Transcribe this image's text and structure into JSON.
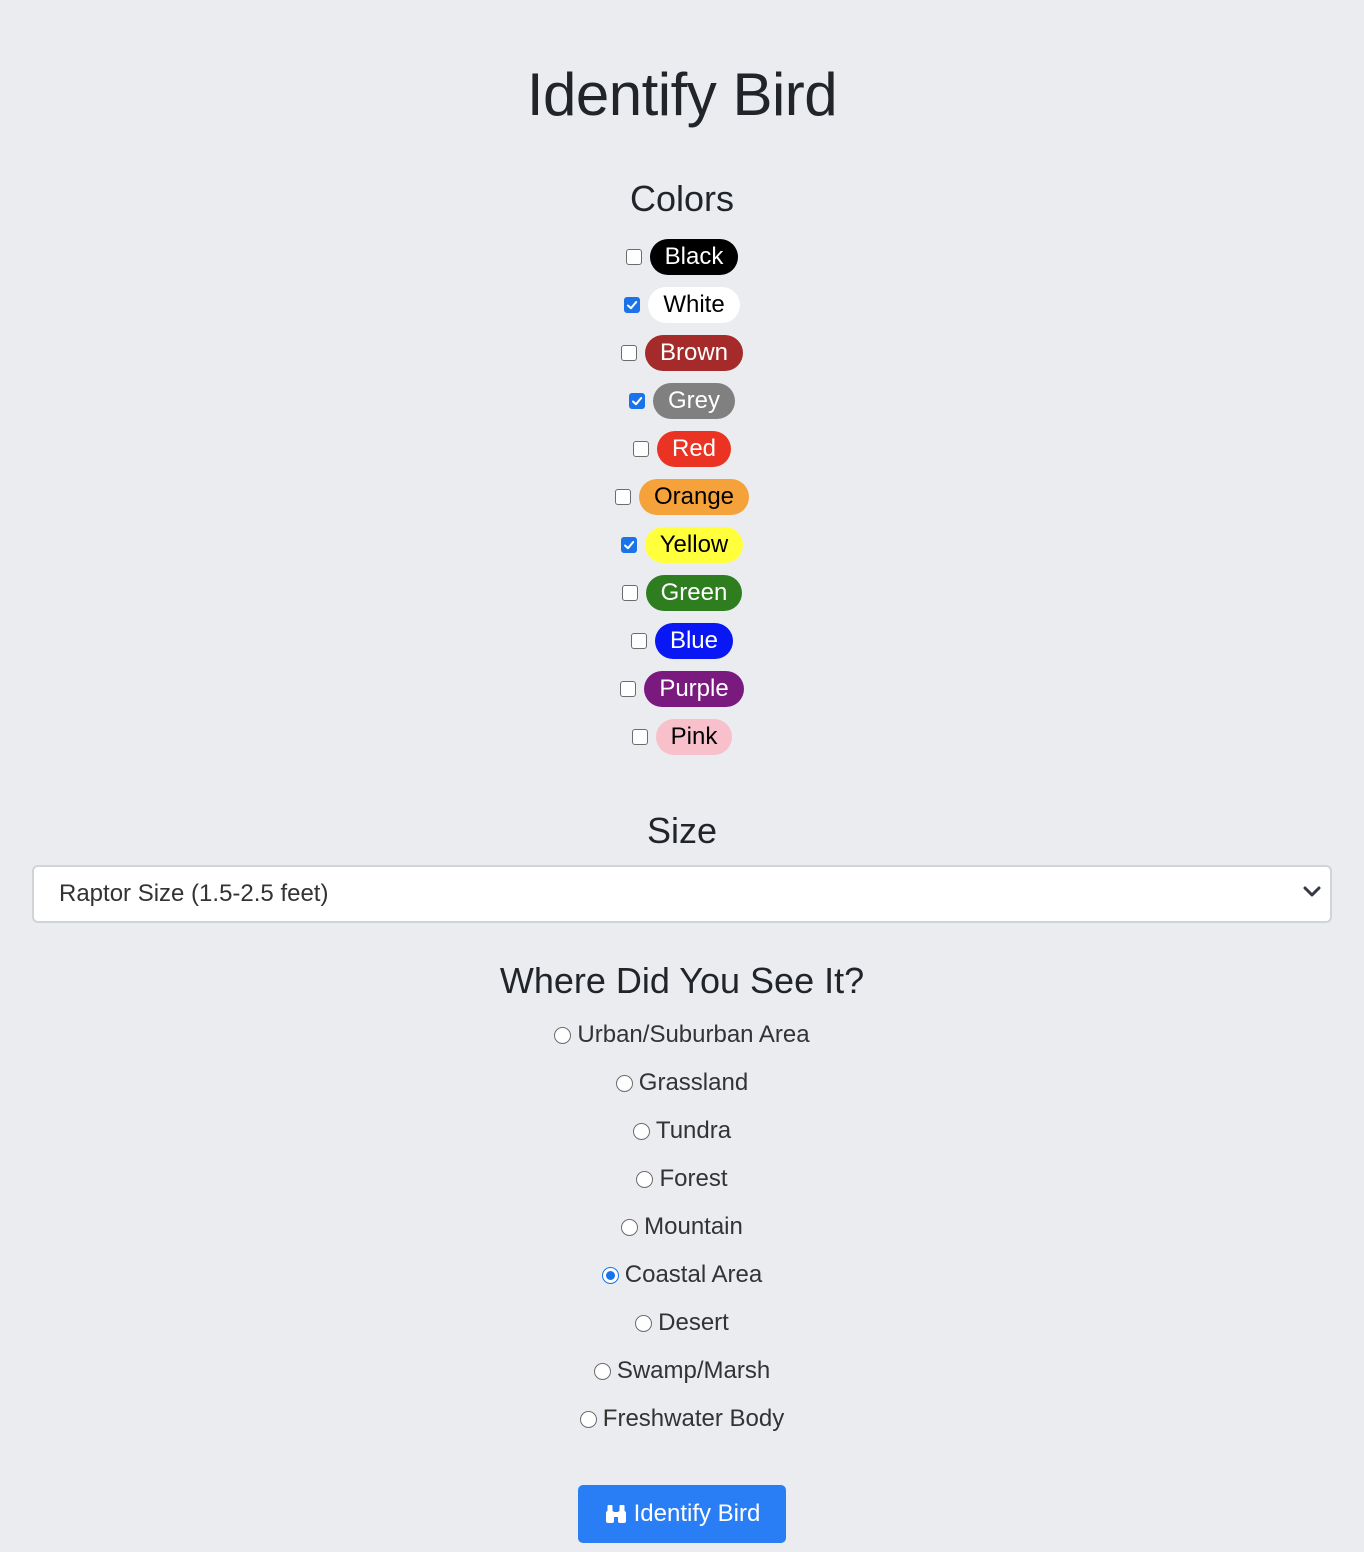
{
  "page_title": "Identify Bird",
  "colors": {
    "heading": "Colors",
    "items": [
      {
        "label": "Black",
        "checked": false,
        "bg": "#000000",
        "fg": "#ffffff"
      },
      {
        "label": "White",
        "checked": true,
        "bg": "#ffffff",
        "fg": "#000000"
      },
      {
        "label": "Brown",
        "checked": false,
        "bg": "#a52a2a",
        "fg": "#ffffff"
      },
      {
        "label": "Grey",
        "checked": true,
        "bg": "#808080",
        "fg": "#ffffff"
      },
      {
        "label": "Red",
        "checked": false,
        "bg": "#ea3323",
        "fg": "#ffffff"
      },
      {
        "label": "Orange",
        "checked": false,
        "bg": "#f5a23a",
        "fg": "#000000"
      },
      {
        "label": "Yellow",
        "checked": true,
        "bg": "#ffff3c",
        "fg": "#000000"
      },
      {
        "label": "Green",
        "checked": false,
        "bg": "#2e7d1f",
        "fg": "#ffffff"
      },
      {
        "label": "Blue",
        "checked": false,
        "bg": "#0a17f5",
        "fg": "#ffffff"
      },
      {
        "label": "Purple",
        "checked": false,
        "bg": "#7a1a7e",
        "fg": "#ffffff"
      },
      {
        "label": "Pink",
        "checked": false,
        "bg": "#f7c0ca",
        "fg": "#000000"
      }
    ]
  },
  "size": {
    "heading": "Size",
    "selected": "Raptor Size (1.5-2.5 feet)"
  },
  "habitat": {
    "heading": "Where Did You See It?",
    "options": [
      {
        "label": "Urban/Suburban Area",
        "selected": false
      },
      {
        "label": "Grassland",
        "selected": false
      },
      {
        "label": "Tundra",
        "selected": false
      },
      {
        "label": "Forest",
        "selected": false
      },
      {
        "label": "Mountain",
        "selected": false
      },
      {
        "label": "Coastal Area",
        "selected": true
      },
      {
        "label": "Desert",
        "selected": false
      },
      {
        "label": "Swamp/Marsh",
        "selected": false
      },
      {
        "label": "Freshwater Body",
        "selected": false
      }
    ]
  },
  "submit": {
    "label": "Identify Bird",
    "icon": "binoculars-icon",
    "color": "#2a7ef5"
  }
}
